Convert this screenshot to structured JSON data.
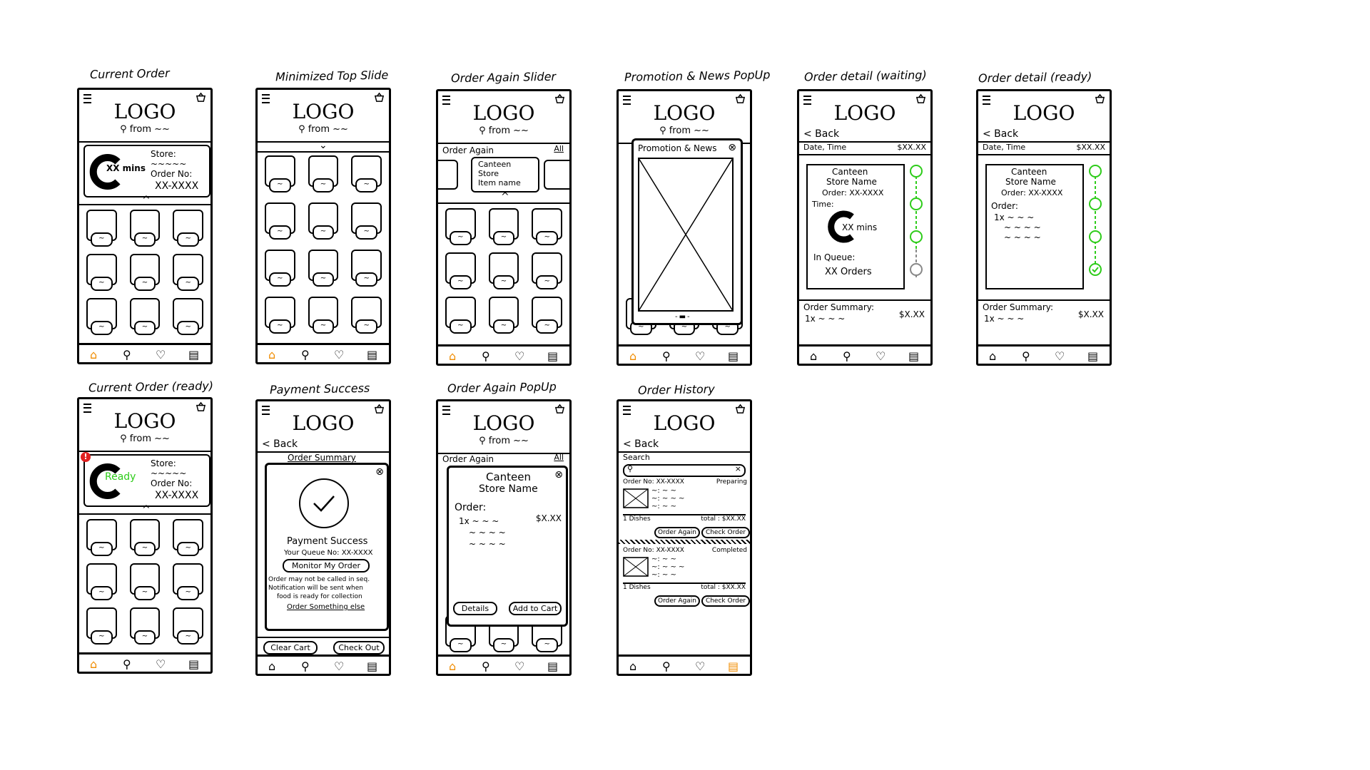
{
  "captions": {
    "current_order": "Current Order",
    "minimized": "Minimized Top Slide",
    "order_again_slider": "Order Again Slider",
    "promotion": "Promotion & News PopUp",
    "detail_waiting": "Order detail (waiting)",
    "detail_ready": "Order detail (ready)",
    "current_ready": "Current Order (ready)",
    "payment": "Payment Success",
    "order_again_popup": "Order Again PopUp",
    "history": "Order History"
  },
  "common": {
    "logo": "LOGO",
    "location": "from ~~",
    "back": "< Back",
    "tilde": "~",
    "tilde_row": "~ ~ ~",
    "date_time": "Date, Time",
    "price": "$XX.XX",
    "all": "All"
  },
  "current": {
    "store_label": "Store:",
    "store_value": "~~~~~",
    "order_label": "Order No:",
    "order_value": "XX-XXXX",
    "timer": "XX mins",
    "ready": "Ready"
  },
  "order_again": {
    "title": "Order Again",
    "item_line1": "Canteen",
    "item_line2": "Store",
    "item_line3": "Item name"
  },
  "promotion": {
    "title": "Promotion & News"
  },
  "detail": {
    "canteen": "Canteen",
    "store_name": "Store Name",
    "order_no": "Order: XX-XXXX",
    "time": "Time:",
    "timer": "XX mins",
    "in_queue": "In Queue:",
    "queue_value": "XX Orders",
    "order": "Order:",
    "item1": "1x ~ ~ ~",
    "item2": "~ ~ ~ ~",
    "item3": "~ ~ ~ ~",
    "summary": "Order Summary:",
    "summary_item": "1x ~ ~ ~",
    "summary_price": "$X.XX"
  },
  "payment": {
    "summary_title": "Order Summary",
    "title": "Payment Success",
    "queue": "Your Queue No: XX-XXXX",
    "monitor": "Monitor My Order",
    "note1": "Order may not be called in seq.",
    "note2": "Notification will be sent when",
    "note3": "food is ready for collection",
    "link": "Order Something else",
    "clear": "Clear Cart",
    "checkout": "Check Out"
  },
  "again_popup": {
    "canteen": "Canteen",
    "store": "Store Name",
    "order": "Order:",
    "item1": "1x ~ ~ ~",
    "price": "$X.XX",
    "item2": "~ ~ ~ ~",
    "item3": "~ ~ ~ ~",
    "details": "Details",
    "add": "Add to Cart"
  },
  "history": {
    "search": "Search",
    "orders": [
      {
        "no": "Order No: XX-XXXX",
        "status": "Preparing",
        "line1": "~: ~ ~",
        "line2": "~: ~ ~ ~",
        "line3": "~: ~ ~",
        "dishes": "1 Dishes",
        "total": "total : $XX.XX",
        "again": "Order Again",
        "check": "Check Order"
      },
      {
        "no": "Order No: XX-XXXX",
        "status": "Completed",
        "line1": "~: ~ ~",
        "line2": "~: ~ ~ ~",
        "line3": "~: ~ ~",
        "dishes": "1 Dishes",
        "total": "total : $XX.XX",
        "again": "Order Again",
        "check": "Check Order"
      }
    ]
  },
  "colors": {
    "accent_orange": "#f08c00",
    "ready_green": "#2ecc1a",
    "alert_red": "#e02020"
  }
}
